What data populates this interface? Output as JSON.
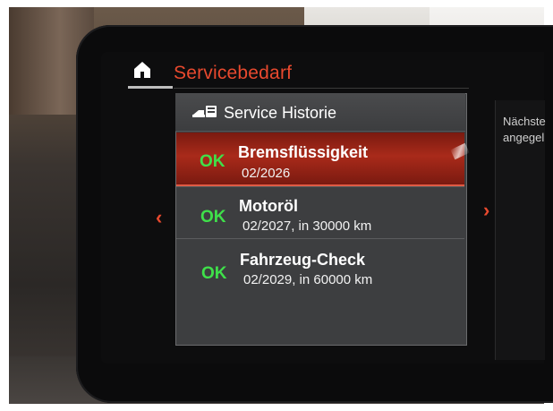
{
  "header": {
    "title": "Servicebedarf"
  },
  "panel": {
    "header_text": "Service Historie",
    "header_icon": "car-service-icon"
  },
  "rows": [
    {
      "status": "OK",
      "title": "Bremsflüssigkeit",
      "detail": "02/2026",
      "selected": true
    },
    {
      "status": "OK",
      "title": "Motoröl",
      "detail": "02/2027, in 30000 km",
      "selected": false
    },
    {
      "status": "OK",
      "title": "Fahrzeug-Check",
      "detail": "02/2029, in 60000 km",
      "selected": false
    }
  ],
  "side_panel": {
    "line1": "Nächste",
    "line2": "angegel"
  },
  "nav": {
    "left_arrow": "‹",
    "right_arrow": "›"
  },
  "colors": {
    "accent": "#e8492e",
    "ok": "#3fe04a",
    "selected_row": "#a92a1a"
  }
}
